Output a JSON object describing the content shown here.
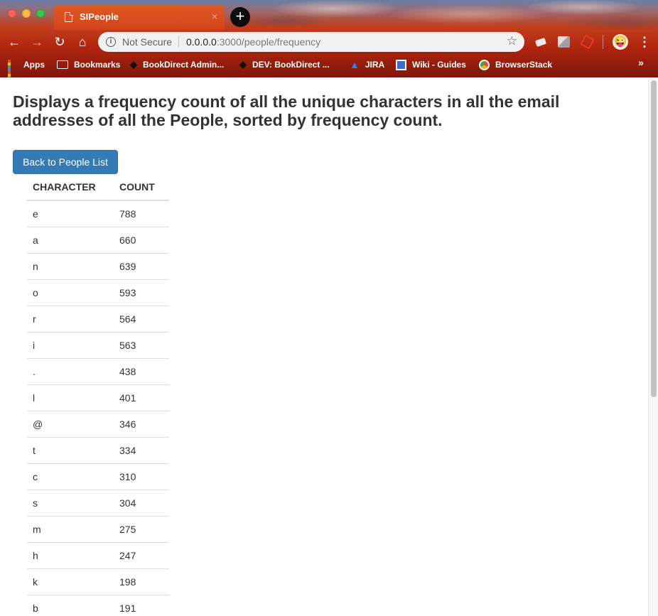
{
  "browser": {
    "tab_title": "SIPeople",
    "tab_close": "×",
    "new_tab": "+",
    "security_label": "Not Secure",
    "url_host": "0.0.0.0",
    "url_rest": ":3000/people/frequency",
    "bookmarks": [
      {
        "label": "Apps",
        "icon": "apps-grid-icon"
      },
      {
        "label": "Bookmarks",
        "icon": "folder-icon"
      },
      {
        "label": "BookDirect Admin...",
        "icon": "bookdirect-icon"
      },
      {
        "label": "DEV: BookDirect ...",
        "icon": "bookdirect-icon"
      },
      {
        "label": "JIRA",
        "icon": "jira-icon"
      },
      {
        "label": "Wiki - Guides",
        "icon": "wiki-icon"
      },
      {
        "label": "BrowserStack",
        "icon": "browserstack-icon"
      }
    ],
    "bookmarks_more": "»"
  },
  "page": {
    "heading": "Displays a frequency count of all the unique characters in all the email addresses of all the People, sorted by frequency count.",
    "back_button": "Back to People List",
    "table": {
      "headers": [
        "CHARACTER",
        "COUNT"
      ],
      "rows": [
        [
          "e",
          "788"
        ],
        [
          "a",
          "660"
        ],
        [
          "n",
          "639"
        ],
        [
          "o",
          "593"
        ],
        [
          "r",
          "564"
        ],
        [
          "i",
          "563"
        ],
        [
          ".",
          "438"
        ],
        [
          "l",
          "401"
        ],
        [
          "@",
          "346"
        ],
        [
          "t",
          "334"
        ],
        [
          "c",
          "310"
        ],
        [
          "s",
          "304"
        ],
        [
          "m",
          "275"
        ],
        [
          "h",
          "247"
        ],
        [
          "k",
          "198"
        ],
        [
          "b",
          "191"
        ]
      ]
    }
  },
  "colors": {
    "button": "#337ab7",
    "chrome_red": "#b2250f",
    "text": "#333333"
  }
}
